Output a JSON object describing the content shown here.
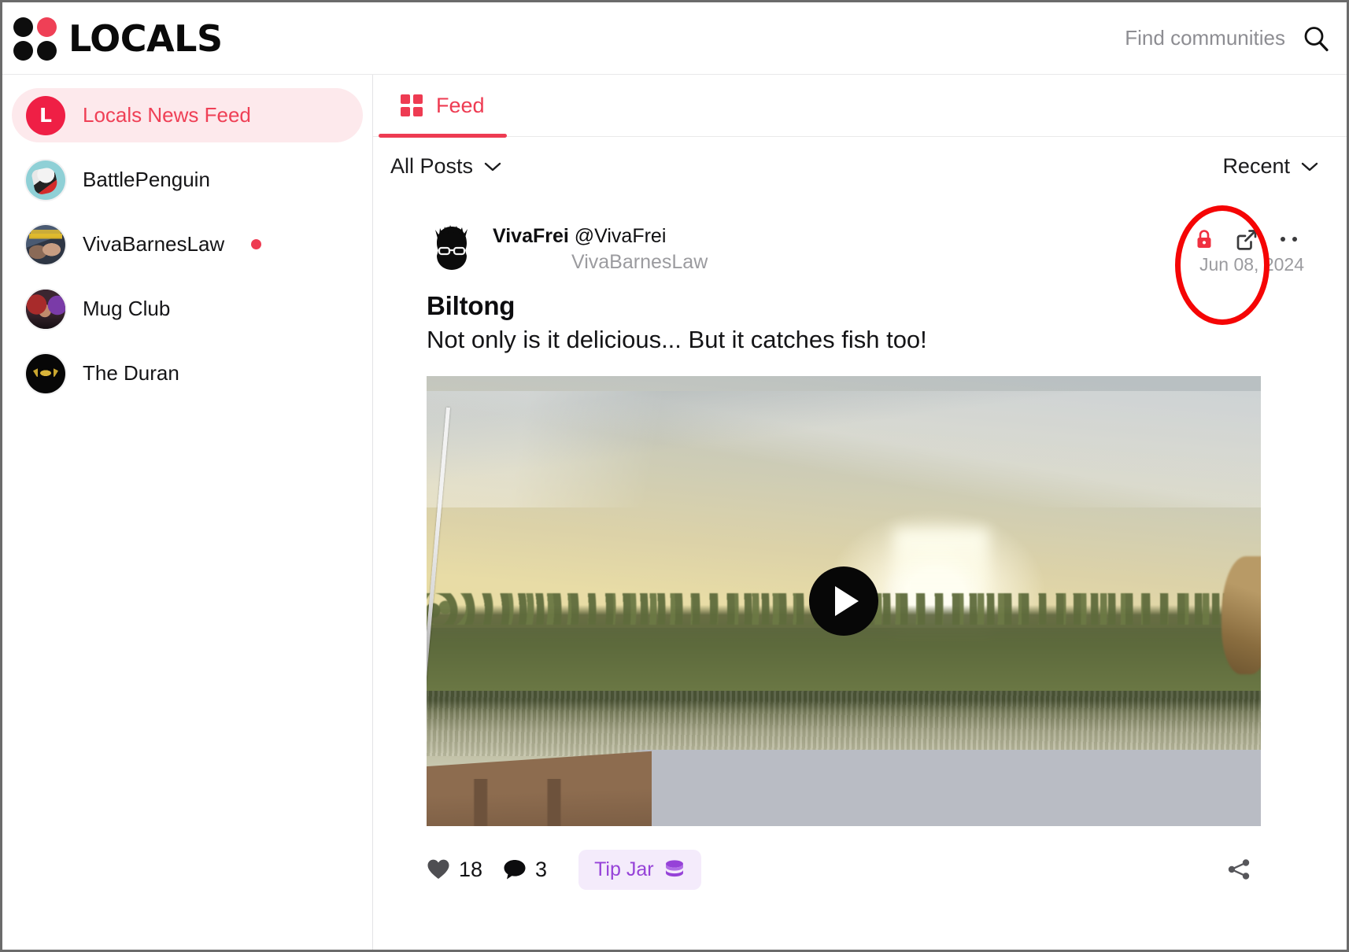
{
  "header": {
    "brand_name": "LOCALS",
    "brand_accent_color": "#ef4056",
    "search_placeholder": "Find communities",
    "search_icon": "search-icon"
  },
  "sidebar": {
    "items": [
      {
        "label": "Locals News Feed",
        "avatar": "locals-logo-avatar",
        "active": true,
        "notification": false
      },
      {
        "label": "BattlePenguin",
        "avatar": "battlepenguin-avatar",
        "active": false,
        "notification": false
      },
      {
        "label": "VivaBarnesLaw",
        "avatar": "vivabarneslaw-avatar",
        "active": false,
        "notification": true
      },
      {
        "label": "Mug Club",
        "avatar": "mugclub-avatar",
        "active": false,
        "notification": false
      },
      {
        "label": "The Duran",
        "avatar": "theduran-avatar",
        "active": false,
        "notification": false
      }
    ]
  },
  "main": {
    "tabs": [
      {
        "label": "Feed",
        "icon": "grid-icon",
        "active": true
      }
    ],
    "filters": {
      "posts_filter_label": "All Posts",
      "sort_label": "Recent"
    }
  },
  "post": {
    "author_name": "VivaFrei",
    "author_handle": "@VivaFrei",
    "community": "VivaBarnesLaw",
    "date": "Jun 08, 2024",
    "title": "Biltong",
    "body": "Not only is it delicious... But it catches fish too!",
    "locked_icon": "lock-icon",
    "external_link_icon": "external-link-icon",
    "more_icon": "more-options-icon",
    "media": {
      "type": "video",
      "play_icon": "play-icon"
    },
    "actions": {
      "like_icon": "heart-icon",
      "like_count": "18",
      "comment_icon": "comment-bubble-icon",
      "comment_count": "3",
      "tip_jar_label": "Tip Jar",
      "tip_jar_icon": "coins-icon",
      "tip_jar_color": "#9642d8",
      "share_icon": "share-icon"
    }
  },
  "annotation": {
    "shape": "ellipse",
    "color": "#f50505",
    "target": "external-link-icon"
  }
}
